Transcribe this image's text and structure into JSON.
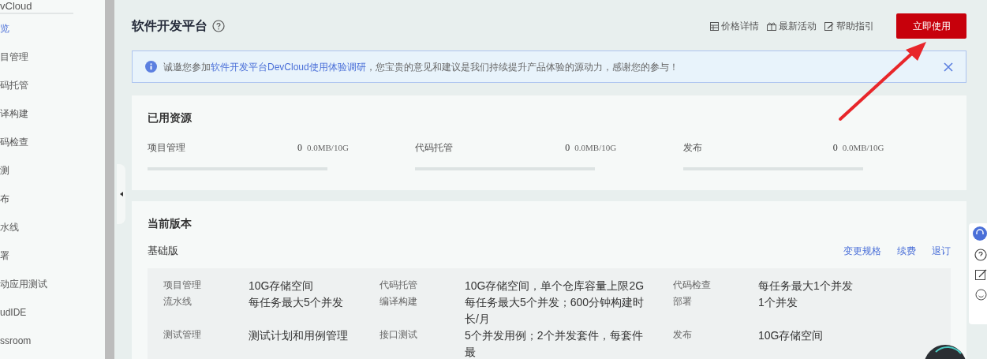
{
  "sidebar": {
    "title": "vCloud",
    "items": [
      {
        "label": "览",
        "selected": true
      },
      {
        "label": "目管理",
        "selected": false
      },
      {
        "label": "码托管",
        "selected": false
      },
      {
        "label": "译构建",
        "selected": false
      },
      {
        "label": "码检查",
        "selected": false
      },
      {
        "label": "测",
        "selected": false
      },
      {
        "label": "布",
        "selected": false
      },
      {
        "label": "水线",
        "selected": false
      },
      {
        "label": "署",
        "selected": false
      },
      {
        "label": "动应用测试",
        "selected": false
      },
      {
        "label": "udIDE",
        "selected": false
      },
      {
        "label": "ssroom",
        "selected": false
      }
    ]
  },
  "header": {
    "title": "软件开发平台",
    "links": [
      {
        "kind": "price",
        "label": "价格详情"
      },
      {
        "kind": "gift",
        "label": "最新活动"
      },
      {
        "kind": "guide",
        "label": "帮助指引"
      }
    ],
    "primary_button": "立即使用"
  },
  "notice": {
    "prefix": "诚邀您参加",
    "link": "软件开发平台DevCloud使用体验调研",
    "suffix": "，您宝贵的意见和建议是我们持续提升产品体验的源动力，感谢您的参与！"
  },
  "resources": {
    "title": "已用资源",
    "items": [
      {
        "name": "项目管理",
        "count": "0",
        "usage": "0.0MB/10G",
        "level": 0
      },
      {
        "name": "代码托管",
        "count": "0",
        "usage": "0.0MB/10G",
        "level": 0
      },
      {
        "name": "发布",
        "count": "0",
        "usage": "0.0MB/10G",
        "level": 0
      }
    ]
  },
  "version": {
    "title": "当前版本",
    "edition": "基础版",
    "actions": [
      "变更规格",
      "续费",
      "退订"
    ],
    "rows": [
      [
        {
          "name": "项目管理",
          "value": "10G存储空间"
        },
        {
          "name": "代码托管",
          "value": "10G存储空间，单个仓库容量上限2G"
        },
        {
          "name": "代码检查",
          "value": "每任务最大1个并发"
        }
      ],
      [
        {
          "name": "流水线",
          "value": "每任务最大5个并发"
        },
        {
          "name": "编译构建",
          "value": "每任务最大5个并发；600分钟构建时长/月"
        },
        {
          "name": "部署",
          "value": "1个并发"
        }
      ],
      [
        {
          "name": "测试管理",
          "value": "测试计划和用例管理"
        },
        {
          "name": "接口测试",
          "value": "5个并发用例；2个并发套件，每套件最"
        },
        {
          "name": "发布",
          "value": "10G存储空间"
        }
      ]
    ]
  },
  "float_toolbar": [
    {
      "kind": "service"
    },
    {
      "kind": "help"
    },
    {
      "kind": "edit"
    },
    {
      "kind": "smile"
    }
  ]
}
